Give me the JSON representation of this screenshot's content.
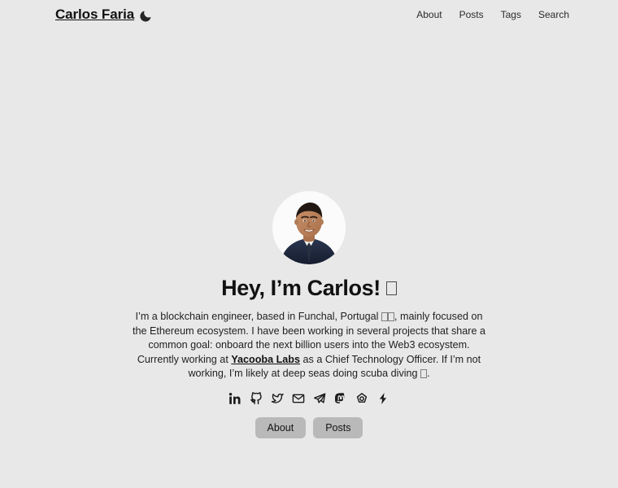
{
  "site": {
    "brand": "Carlos Faria",
    "theme_toggle_icon": "moon-icon",
    "background_color": "#e8e8e8",
    "button_color": "#b9b9b9"
  },
  "nav": {
    "items": [
      {
        "label": "About"
      },
      {
        "label": "Posts"
      },
      {
        "label": "Tags"
      },
      {
        "label": "Search"
      }
    ]
  },
  "profile": {
    "avatar_alt": "Portrait photo of Carlos Faria wearing a navy suit and tie",
    "heading": "Hey, I’m Carlos!",
    "heading_emoji_missing_glyph": "□",
    "bio": {
      "part1": "I’m a blockchain engineer, based in Funchal, Portugal ",
      "flag_missing_glyph": "□□",
      "part2": ", mainly focused on the Ethereum ecosystem. I have been working in several projects that share a common goal: onboard the next billion users into the Web3 ecosystem. Currently working at ",
      "company": "Yacooba Labs",
      "part3": " as a Chief Technology Officer. If I’m not working, I’m likely at deep seas doing scuba diving ",
      "diving_missing_glyph": "□",
      "part4": "."
    }
  },
  "socials": {
    "items": [
      {
        "name": "linkedin-icon",
        "label": "LinkedIn"
      },
      {
        "name": "github-icon",
        "label": "GitHub"
      },
      {
        "name": "twitter-icon",
        "label": "Twitter"
      },
      {
        "name": "email-icon",
        "label": "Email"
      },
      {
        "name": "telegram-icon",
        "label": "Telegram"
      },
      {
        "name": "mastodon-icon",
        "label": "Mastodon"
      },
      {
        "name": "hashnode-icon",
        "label": "Hashnode"
      },
      {
        "name": "lightning-icon",
        "label": "Lightning"
      }
    ]
  },
  "actions": {
    "buttons": [
      {
        "label": "About"
      },
      {
        "label": "Posts"
      }
    ]
  }
}
